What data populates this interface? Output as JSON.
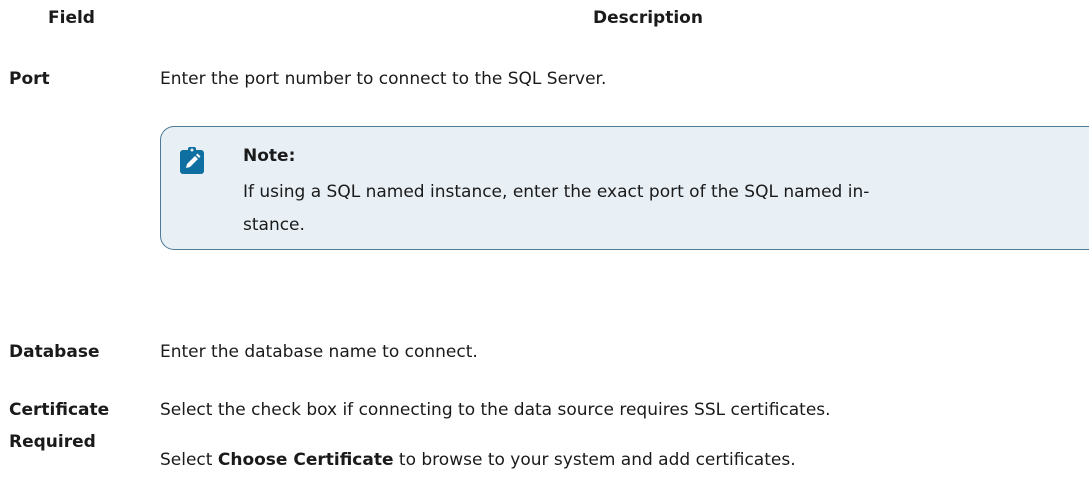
{
  "table": {
    "header": {
      "field": "Field",
      "description": "Description"
    },
    "rows": [
      {
        "field": "Port",
        "description": "Enter the port number to connect to the SQL Server."
      },
      {
        "field": "Database",
        "description": "Enter the database name to connect."
      },
      {
        "field_line1": "Certificate",
        "field_line2": "Required",
        "description_line1": "Select the check box if connecting to the data source requires SSL certificates.",
        "description_line2_prefix": "Select ",
        "description_line2_bold": "Choose Certificate",
        "description_line2_suffix": " to browse to your system and add certificates."
      }
    ],
    "note": {
      "icon": "pencil-note-icon",
      "title": "Note:",
      "text_line1": "If using a SQL named instance, enter the exact port of the SQL named in-",
      "text_line2": "stance."
    }
  },
  "colors": {
    "note_background": "#e8f0f6",
    "note_border": "#4d7a96",
    "note_icon": "#0f6fa0"
  }
}
